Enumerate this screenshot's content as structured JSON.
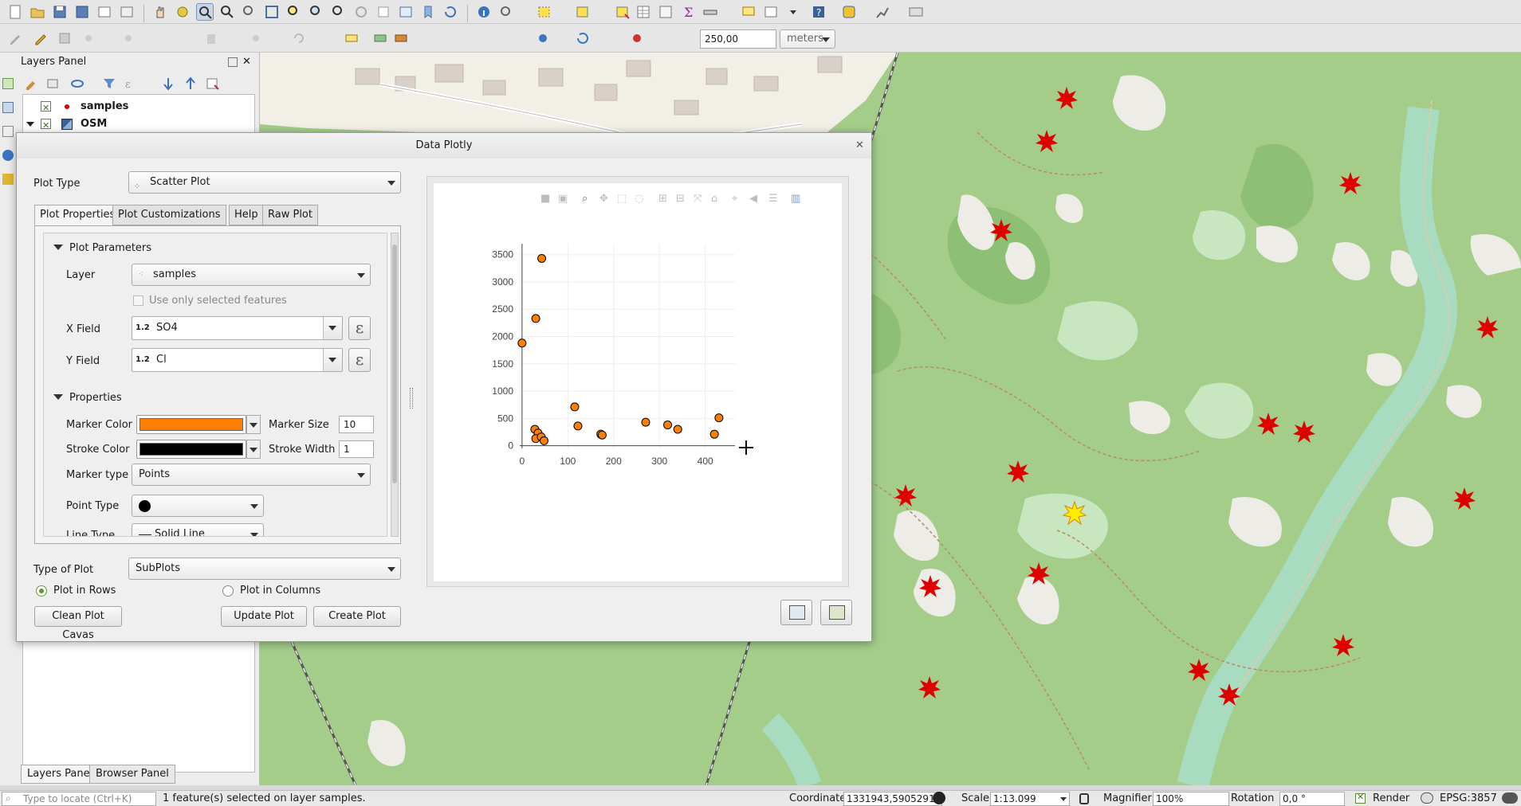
{
  "toolbar2": {
    "scale_value": "250,00",
    "units": "meters"
  },
  "layers_panel": {
    "title": "Layers Panel",
    "layers": [
      {
        "name": "samples"
      },
      {
        "name": "OSM"
      }
    ],
    "tabs": [
      "Layers Panel",
      "Browser Panel"
    ]
  },
  "dialog": {
    "title": "Data Plotly",
    "plot_type_label": "Plot Type",
    "plot_type_value": "Scatter Plot",
    "tabs": [
      "Plot Properties",
      "Plot Customizations",
      "Help",
      "Raw Plot"
    ],
    "section_params": "Plot Parameters",
    "layer_label": "Layer",
    "layer_value": "samples",
    "use_selected_label": "Use only selected features",
    "x_label": "X Field",
    "x_type": "1.2",
    "x_value": "SO4",
    "y_label": "Y Field",
    "y_type": "1.2",
    "y_value": "Cl",
    "epsilon": "ε",
    "section_props": "Properties",
    "marker_color_label": "Marker Color",
    "marker_color": "#ff8000",
    "marker_size_label": "Marker Size",
    "marker_size": "10",
    "stroke_color_label": "Stroke Color",
    "stroke_color": "#000000",
    "stroke_width_label": "Stroke Width",
    "stroke_width": "1",
    "marker_type_label": "Marker type",
    "marker_type_value": "Points",
    "point_type_label": "Point Type",
    "line_type_label": "Line Type",
    "line_type_value": "Solid Line",
    "type_of_plot_label": "Type of Plot",
    "type_of_plot_value": "SubPlots",
    "plot_in_rows": "Plot in Rows",
    "plot_in_columns": "Plot in Columns",
    "clean_btn": "Clean Plot Cavas",
    "update_btn": "Update Plot",
    "create_btn": "Create Plot"
  },
  "chart_data": {
    "type": "scatter",
    "x_ticks": [
      "0",
      "100",
      "200",
      "300",
      "400"
    ],
    "y_ticks": [
      "0",
      "500",
      "1000",
      "1500",
      "2000",
      "2500",
      "3000",
      "3500"
    ],
    "xlim": [
      -5,
      465
    ],
    "ylim": [
      -50,
      3700
    ],
    "points": [
      {
        "x": 0,
        "y": 1880
      },
      {
        "x": 30,
        "y": 2330
      },
      {
        "x": 43,
        "y": 3430
      },
      {
        "x": 28,
        "y": 300
      },
      {
        "x": 35,
        "y": 230
      },
      {
        "x": 30,
        "y": 130
      },
      {
        "x": 42,
        "y": 160
      },
      {
        "x": 48,
        "y": 90
      },
      {
        "x": 115,
        "y": 710
      },
      {
        "x": 122,
        "y": 360
      },
      {
        "x": 172,
        "y": 210
      },
      {
        "x": 175,
        "y": 195
      },
      {
        "x": 270,
        "y": 430
      },
      {
        "x": 318,
        "y": 380
      },
      {
        "x": 340,
        "y": 300
      },
      {
        "x": 420,
        "y": 210
      },
      {
        "x": 430,
        "y": 510
      }
    ],
    "marker_color": "#ff8000",
    "stroke_color": "#000000",
    "grid": true
  },
  "status_bar": {
    "locate_placeholder": "Type to locate (Ctrl+K)",
    "message": "1 feature(s) selected on layer samples.",
    "coordinate_label": "Coordinate",
    "coordinate_value": "1331943,5905291",
    "scale_label": "Scale",
    "scale_value": "1:13.099",
    "magnifier_label": "Magnifier",
    "magnifier_value": "100%",
    "rotation_label": "Rotation",
    "rotation_value": "0,0 °",
    "render_label": "Render",
    "crs": "EPSG:3857"
  },
  "colors": {
    "map_green": "#a3cd89",
    "marker_red": "#e00000",
    "selected_yellow": "#ffee00"
  }
}
